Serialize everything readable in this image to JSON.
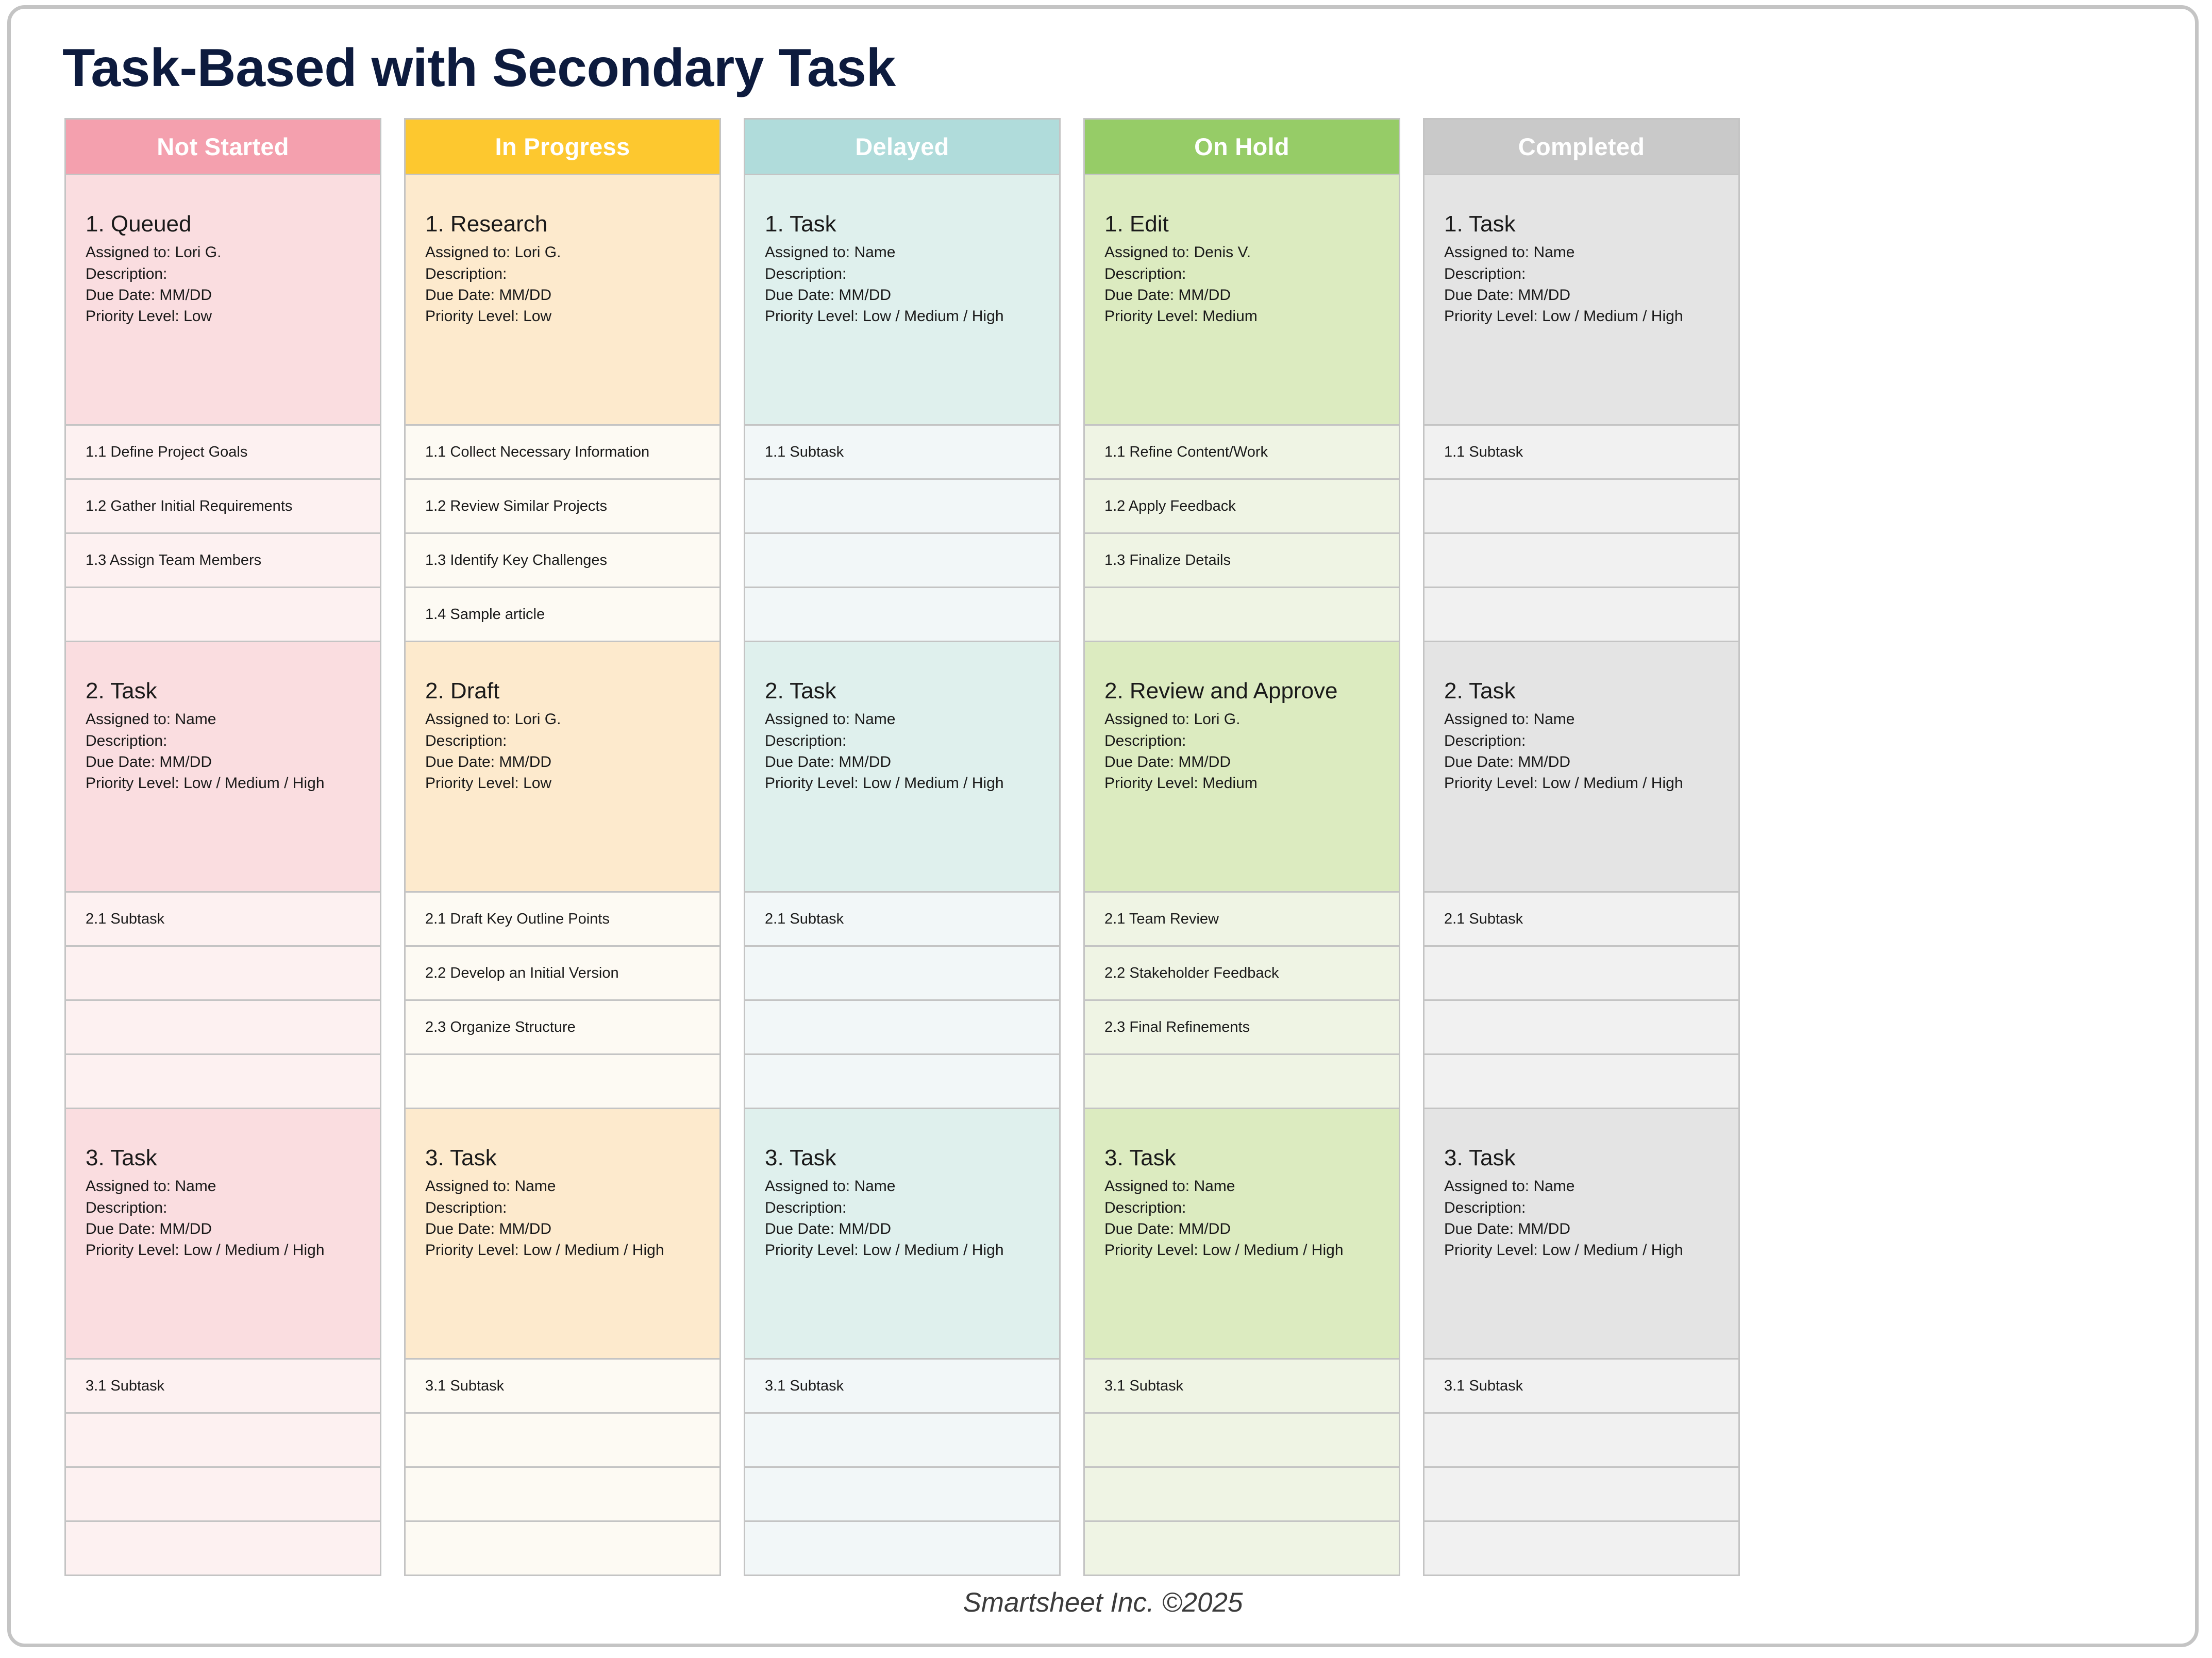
{
  "page": {
    "title": "Task-Based with Secondary Task",
    "footer": "Smartsheet Inc. ©2025",
    "title_color": "#0d1b3e",
    "border_color": "#c4c4c4"
  },
  "columns": [
    {
      "name": "not-started",
      "header": "Not Started",
      "header_color": "#f4a0ae",
      "card_color": "#fadde0",
      "subtask_color": "#fdf1f1",
      "tasks": [
        {
          "title": "1. Queued",
          "assigned": "Assigned to: Lori G.",
          "description": "Description:",
          "due_date": "Due Date: MM/DD",
          "priority": "Priority Level: Low",
          "subtasks": [
            "1.1 Define Project Goals",
            "1.2 Gather Initial Requirements",
            "1.3 Assign Team Members",
            ""
          ]
        },
        {
          "title": "2. Task",
          "assigned": "Assigned to: Name",
          "description": "Description:",
          "due_date": "Due Date: MM/DD",
          "priority": "Priority Level: Low / Medium / High",
          "subtasks": [
            "2.1 Subtask",
            "",
            "",
            ""
          ]
        },
        {
          "title": "3. Task",
          "assigned": "Assigned to: Name",
          "description": "Description:",
          "due_date": "Due Date: MM/DD",
          "priority": "Priority Level: Low / Medium / High",
          "subtasks": [
            "3.1 Subtask",
            "",
            "",
            ""
          ]
        }
      ]
    },
    {
      "name": "in-progress",
      "header": "In Progress",
      "header_color": "#fdc82f",
      "card_color": "#fdeacd",
      "subtask_color": "#fdfaf3",
      "tasks": [
        {
          "title": "1. Research",
          "assigned": "Assigned to: Lori G.",
          "description": "Description:",
          "due_date": "Due Date: MM/DD",
          "priority": "Priority Level: Low",
          "subtasks": [
            "1.1 Collect Necessary Information",
            "1.2 Review Similar Projects",
            "1.3 Identify Key Challenges",
            "1.4 Sample article"
          ]
        },
        {
          "title": "2. Draft",
          "assigned": "Assigned to: Lori G.",
          "description": "Description:",
          "due_date": "Due Date: MM/DD",
          "priority": "Priority Level: Low",
          "subtasks": [
            "2.1 Draft Key Outline Points",
            "2.2 Develop an Initial Version",
            "2.3 Organize Structure",
            ""
          ]
        },
        {
          "title": "3. Task",
          "assigned": "Assigned to: Name",
          "description": "Description:",
          "due_date": "Due Date: MM/DD",
          "priority": "Priority Level: Low / Medium / High",
          "subtasks": [
            "3.1 Subtask",
            "",
            "",
            ""
          ]
        }
      ]
    },
    {
      "name": "delayed",
      "header": "Delayed",
      "header_color": "#b0dcdb",
      "card_color": "#dff0ed",
      "subtask_color": "#f2f7f8",
      "tasks": [
        {
          "title": "1. Task",
          "assigned": "Assigned to: Name",
          "description": "Description:",
          "due_date": "Due Date: MM/DD",
          "priority": "Priority Level: Low / Medium / High",
          "subtasks": [
            "1.1 Subtask",
            "",
            "",
            ""
          ]
        },
        {
          "title": "2. Task",
          "assigned": "Assigned to: Name",
          "description": "Description:",
          "due_date": "Due Date: MM/DD",
          "priority": "Priority Level: Low / Medium / High",
          "subtasks": [
            "2.1 Subtask",
            "",
            "",
            ""
          ]
        },
        {
          "title": "3. Task",
          "assigned": "Assigned to: Name",
          "description": "Description:",
          "due_date": "Due Date: MM/DD",
          "priority": "Priority Level: Low / Medium / High",
          "subtasks": [
            "3.1 Subtask",
            "",
            "",
            ""
          ]
        }
      ]
    },
    {
      "name": "on-hold",
      "header": "On Hold",
      "header_color": "#96cc67",
      "card_color": "#dcebc0",
      "subtask_color": "#eff4e4",
      "tasks": [
        {
          "title": "1. Edit",
          "assigned": "Assigned to: Denis V.",
          "description": "Description:",
          "due_date": "Due Date: MM/DD",
          "priority": "Priority Level: Medium",
          "subtasks": [
            "1.1 Refine Content/Work",
            "1.2 Apply Feedback",
            "1.3 Finalize Details",
            ""
          ]
        },
        {
          "title": "2. Review and Approve",
          "assigned": "Assigned to: Lori G.",
          "description": "Description:",
          "due_date": "Due Date: MM/DD",
          "priority": "Priority Level: Medium",
          "subtasks": [
            "2.1 Team Review",
            "2.2 Stakeholder Feedback",
            "2.3 Final Refinements",
            ""
          ]
        },
        {
          "title": "3. Task",
          "assigned": "Assigned to: Name",
          "description": "Description:",
          "due_date": "Due Date: MM/DD",
          "priority": "Priority Level: Low / Medium / High",
          "subtasks": [
            "3.1 Subtask",
            "",
            "",
            ""
          ]
        }
      ]
    },
    {
      "name": "completed",
      "header": "Completed",
      "header_color": "#c9c9c9",
      "card_color": "#e4e4e4",
      "subtask_color": "#f1f1f1",
      "tasks": [
        {
          "title": "1. Task",
          "assigned": "Assigned to: Name",
          "description": "Description:",
          "due_date": "Due Date: MM/DD",
          "priority": "Priority Level: Low / Medium / High",
          "subtasks": [
            "1.1 Subtask",
            "",
            "",
            ""
          ]
        },
        {
          "title": "2. Task",
          "assigned": "Assigned to: Name",
          "description": "Description:",
          "due_date": "Due Date: MM/DD",
          "priority": "Priority Level: Low / Medium / High",
          "subtasks": [
            "2.1 Subtask",
            "",
            "",
            ""
          ]
        },
        {
          "title": "3. Task",
          "assigned": "Assigned to: Name",
          "description": "Description:",
          "due_date": "Due Date: MM/DD",
          "priority": "Priority Level: Low / Medium / High",
          "subtasks": [
            "3.1 Subtask",
            "",
            "",
            ""
          ]
        }
      ]
    }
  ]
}
